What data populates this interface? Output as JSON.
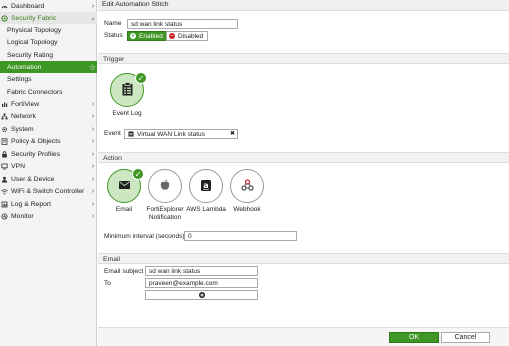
{
  "sidebar": {
    "items": [
      {
        "label": "Dashboard",
        "icon": "dashboard-icon",
        "chevron": "›"
      },
      {
        "label": "Security Fabric",
        "icon": "security-fabric-icon",
        "chevron": "⌄"
      },
      {
        "label": "Physical Topology"
      },
      {
        "label": "Logical Topology"
      },
      {
        "label": "Security Rating"
      },
      {
        "label": "Automation",
        "star": "☆"
      },
      {
        "label": "Settings"
      },
      {
        "label": "Fabric Connectors"
      },
      {
        "label": "FortiView",
        "icon": "fortiview-icon",
        "chevron": "›"
      },
      {
        "label": "Network",
        "icon": "network-icon",
        "chevron": "›"
      },
      {
        "label": "System",
        "icon": "system-icon",
        "chevron": "›"
      },
      {
        "label": "Policy & Objects",
        "icon": "policy-icon",
        "chevron": "›"
      },
      {
        "label": "Security Profiles",
        "icon": "security-profiles-icon",
        "chevron": "›"
      },
      {
        "label": "VPN",
        "icon": "vpn-icon",
        "chevron": "›"
      },
      {
        "label": "User & Device",
        "icon": "user-device-icon",
        "chevron": "›"
      },
      {
        "label": "WiFi & Switch Controller",
        "icon": "wifi-icon",
        "chevron": "›"
      },
      {
        "label": "Log & Report",
        "icon": "log-report-icon",
        "chevron": "›"
      },
      {
        "label": "Monitor",
        "icon": "monitor-icon",
        "chevron": "›"
      }
    ]
  },
  "page": {
    "title": "Edit Automation Stitch"
  },
  "form": {
    "name_label": "Name",
    "name_value": "sd wan link status",
    "status_label": "Status",
    "enabled_label": "Enabled",
    "disabled_label": "Disabled"
  },
  "trigger": {
    "section_title": "Trigger",
    "tile_label": "Event Log",
    "event_label": "Event",
    "event_value": "Virtual WAN Link status",
    "clear_icon": "✖"
  },
  "action": {
    "section_title": "Action",
    "tiles": [
      {
        "label": "Email"
      },
      {
        "label": "FortiExplorer",
        "label2": "Notification"
      },
      {
        "label": "AWS Lambda"
      },
      {
        "label": "Webhook"
      }
    ],
    "min_interval_label": "Minimum interval (seconds)",
    "min_interval_value": "0"
  },
  "email": {
    "section_title": "Email",
    "subject_label": "Email subject",
    "subject_value": "sd wan link status",
    "to_label": "To",
    "to_value": "praveen@example.com"
  },
  "footer": {
    "ok_label": "OK",
    "cancel_label": "Cancel"
  },
  "colors": {
    "accent": "#3e9624",
    "danger": "#c8232c"
  }
}
